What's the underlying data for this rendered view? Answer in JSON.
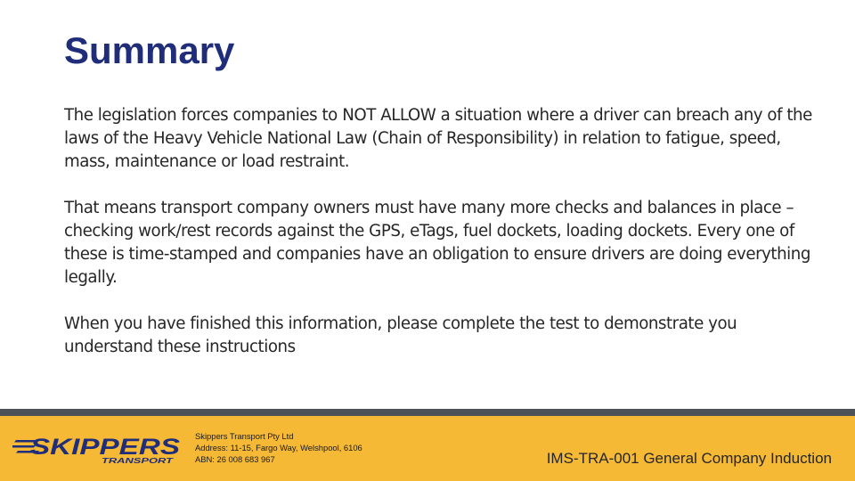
{
  "slide": {
    "title": "Summary",
    "paragraphs": [
      "The legislation forces companies to NOT ALLOW a situation where a driver can breach any of the laws of the Heavy Vehicle National Law (Chain of Responsibility) in relation to fatigue, speed, mass, maintenance or load restraint.",
      "That means transport company owners must have many more checks and balances in place – checking work/rest records against the GPS, eTags, fuel dockets, loading dockets.  Every one of these is time-stamped and companies have an obligation to ensure drivers are doing everything legally.",
      "When you have finished this information, please complete the test to demonstrate you understand these instructions"
    ]
  },
  "footer": {
    "logo": {
      "word": "SKIPPERS",
      "subword": "TRANSPORT"
    },
    "company_name": "Skippers Transport Pty Ltd",
    "address": "Address: 11-15, Fargo Way, Welshpool, 6106",
    "abn": "ABN: 26 008 683 967",
    "document_id": "IMS-TRA-001 General Company Induction"
  },
  "colors": {
    "title": "#1f2d7a",
    "footer_band": "#f6b936",
    "footer_rule": "#4d5258",
    "logo_blue": "#1f2d7a"
  }
}
